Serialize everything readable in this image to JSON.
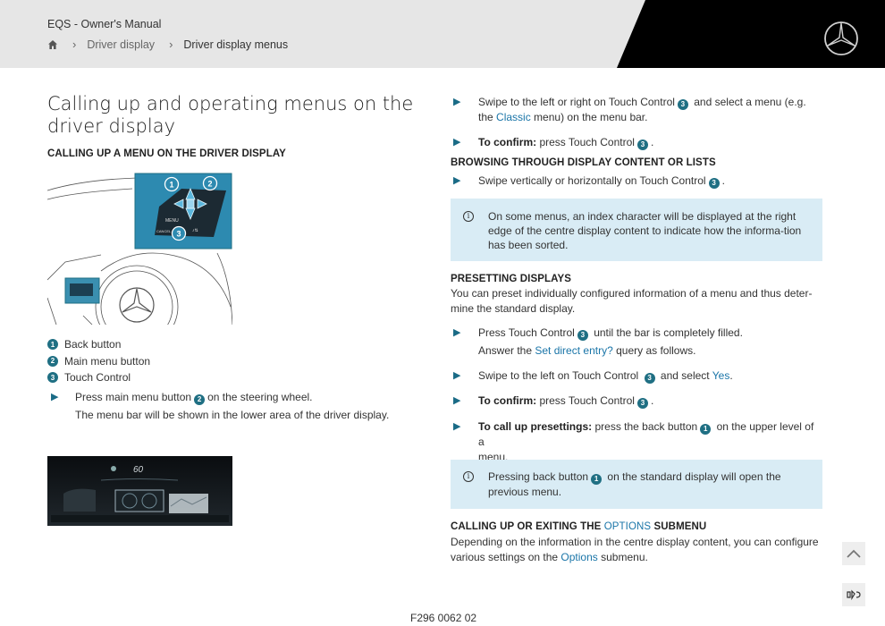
{
  "header": {
    "app_title": "EQS - Owner's Manual",
    "breadcrumb": [
      "Driver display",
      "Driver display menus"
    ]
  },
  "main": {
    "title": "Calling up and operating menus on the driver display",
    "left": {
      "heading": "CALLING UP A MENU ON THE DRIVER DISPLAY",
      "figure_labels": [
        "1",
        "2",
        "3"
      ],
      "figure2_speed": "60",
      "legend": [
        {
          "num": "1",
          "label": "Back button"
        },
        {
          "num": "2",
          "label": "Main menu button"
        },
        {
          "num": "3",
          "label": "Touch Control"
        }
      ],
      "step1_a": "Press main menu button",
      "step1_num": "2",
      "step1_b": "on the steering wheel.",
      "step1_result": "The menu bar will be shown in the lower area of the driver display."
    },
    "right": {
      "s1_a": "Swipe to the left or right on Touch Control",
      "s1_num": "3",
      "s1_b": "and select a menu (e.g.",
      "s1_c": "the",
      "s1_link": "Classic",
      "s1_d": "menu) on the menu bar.",
      "s2_bold": "To confirm:",
      "s2_text": "press Touch Control",
      "s2_num": "3",
      "h2": "BROWSING THROUGH DISPLAY CONTENT OR LISTS",
      "s3_text": "Swipe vertically or horizontally on Touch Control",
      "s3_num": "3",
      "info1": "On some menus, an index character will be displayed at the right edge of the centre display content to indicate how the informa-tion has been sorted.",
      "h3": "PRESETTING DISPLAYS",
      "p3": "You can preset individually configured information of a menu and thus deter-mine the standard display.",
      "s4_a": "Press Touch Control",
      "s4_num": "3",
      "s4_b": "until the bar is completely filled.",
      "s4_r1": "Answer the",
      "s4_link": "Set direct entry?",
      "s4_r2": "query as follows.",
      "s5_a": "Swipe to the left on Touch Control",
      "s5_num": "3",
      "s5_b": "and select",
      "s5_link": "Yes",
      "s6_bold": "To confirm:",
      "s6_text": "press Touch Control",
      "s6_num": "3",
      "s7_bold": "To call up presettings:",
      "s7_a": "press the back button",
      "s7_num": "1",
      "s7_b": "on the upper level of a",
      "s7_c": "menu.",
      "info2_a": "Pressing back button",
      "info2_num": "1",
      "info2_b": "on the standard display will open the",
      "info2_c": "previous menu.",
      "h4_a": "CALLING UP OR EXITING THE",
      "h4_link": "OPTIONS",
      "h4_b": "SUBMENU",
      "p4_a": "Depending on the information in the centre display content, you can configure",
      "p4_b": "various settings on the",
      "p4_link": "Options",
      "p4_c": "submenu."
    }
  },
  "footer": {
    "code": "F296 0062 02"
  },
  "colors": {
    "accent": "#1a75a8",
    "info_bg": "#d9ecf5",
    "badge": "#1f6f83",
    "header_bg": "#e6e6e6"
  },
  "icons": [
    "home-icon",
    "chevron-right-icon",
    "mercedes-star-logo",
    "info-icon",
    "scroll-top-icon",
    "glossary-icon"
  ]
}
